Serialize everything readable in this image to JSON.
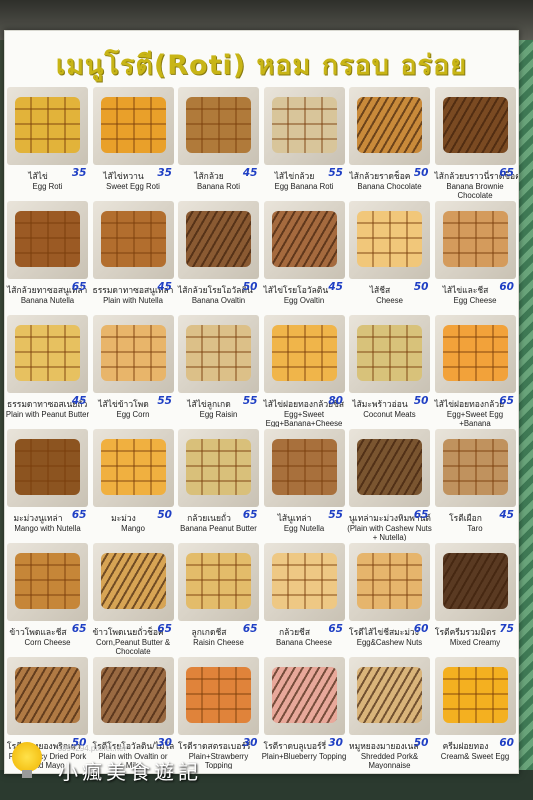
{
  "menu": {
    "title": "เมนูโรตี(Roti) หอม กรอบ อร่อย",
    "items": [
      {
        "thai": "ไส้ไข่",
        "price": "35",
        "english": "Egg Roti",
        "color": "#e2b33a",
        "pattern": "sq"
      },
      {
        "thai": "ไส้ไข่หวาน",
        "price": "35",
        "english": "Sweet Egg Roti",
        "color": "#e9a02a",
        "pattern": "sq"
      },
      {
        "thai": "ไส้กล้วย",
        "price": "45",
        "english": "Banana Roti",
        "color": "#b07a3a",
        "pattern": "sq"
      },
      {
        "thai": "ไส้ไข่กล้วย",
        "price": "55",
        "english": "Egg Banana Roti",
        "color": "#d8c59a",
        "pattern": "sq"
      },
      {
        "thai": "ไส้กล้วยราดช็อค",
        "price": "50",
        "english": "Banana Chocolate",
        "color": "#c98a3a",
        "pattern": "drz"
      },
      {
        "thai": "ไส้กล้วยบราวนี่ราดช็อค",
        "price": "65",
        "english": "Banana Brownie Chocolate",
        "color": "#7a4a22",
        "pattern": "drz"
      },
      {
        "thai": "ไส้กล้วยทาซอสนูเทล่า",
        "price": "65",
        "english": "Banana Nutella",
        "color": "#9b5a24",
        "pattern": "sq"
      },
      {
        "thai": "ธรรมดาทาซอสนูเทล่า",
        "price": "45",
        "english": "Plain with Nutella",
        "color": "#b26e2e",
        "pattern": "sq"
      },
      {
        "thai": "ไส้กล้วยโรยโอวัลติน",
        "price": "50",
        "english": "Banana Ovaltin",
        "color": "#8a5a32",
        "pattern": "drz"
      },
      {
        "thai": "ไส้ไข่โรยโอวัลติน",
        "price": "45",
        "english": "Egg Ovaltin",
        "color": "#a56a3e",
        "pattern": "drz"
      },
      {
        "thai": "ไส้ชีส",
        "price": "50",
        "english": "Cheese",
        "color": "#f1c77a",
        "pattern": "sq"
      },
      {
        "thai": "ไส้ไข่และชีส",
        "price": "60",
        "english": "Egg Cheese",
        "color": "#d49b5c",
        "pattern": "sq"
      },
      {
        "thai": "ธรรมดาทาซอสเนยถั่ว",
        "price": "45",
        "english": "Plain with Peanut Butter",
        "color": "#e7c160",
        "pattern": "sq"
      },
      {
        "thai": "ไส้ไข่ข้าวโพด",
        "price": "55",
        "english": "Egg Corn",
        "color": "#e8b56a",
        "pattern": "sq"
      },
      {
        "thai": "ไส้ไข่ลูกเกด",
        "price": "55",
        "english": "Egg Raisin",
        "color": "#dcc088",
        "pattern": "sq"
      },
      {
        "thai": "ไส้ไข่ฝอยทองกล้วยชีส",
        "price": "80",
        "english": "Egg+Sweet Egg+Banana+Cheese",
        "color": "#f0b54a",
        "pattern": "sq"
      },
      {
        "thai": "ไส้มะพร้าวอ่อน",
        "price": "50",
        "english": "Coconut Meats",
        "color": "#d8c27a",
        "pattern": "sq"
      },
      {
        "thai": "ไส้ไข่ฝอยทองกล้วย",
        "price": "65",
        "english": "Egg+Sweet Egg +Banana",
        "color": "#f2a23a",
        "pattern": "sq"
      },
      {
        "thai": "มะม่วงนูเทล่า",
        "price": "65",
        "english": "Mango with Nutella",
        "color": "#8c5420",
        "pattern": "sq"
      },
      {
        "thai": "มะม่วง",
        "price": "50",
        "english": "Mango",
        "color": "#f0b040",
        "pattern": "sq"
      },
      {
        "thai": "กล้วยเนยถั่ว",
        "price": "65",
        "english": "Banana Peanut Butter",
        "color": "#d9c07a",
        "pattern": "sq"
      },
      {
        "thai": "ไส้นูเทล่า",
        "price": "55",
        "english": "Egg Nutella",
        "color": "#a8703c",
        "pattern": "sq"
      },
      {
        "thai": "นูเทล่ามะม่วงหิมพานต์",
        "price": "65",
        "english": "(Plain with Cashew Nuts + Nutella)",
        "color": "#7a5530",
        "pattern": "drz"
      },
      {
        "thai": "โรตีเผือก",
        "price": "45",
        "english": "Taro",
        "color": "#c0925e",
        "pattern": "sq"
      },
      {
        "thai": "ข้าวโพดและชีส",
        "price": "65",
        "english": "Corn Cheese",
        "color": "#c68638",
        "pattern": "sq"
      },
      {
        "thai": "ข้าวโพดเนยถั่วช็อค",
        "price": "65",
        "english": "Corn,Peanut Butter & Chocolate",
        "color": "#d7a454",
        "pattern": "drz"
      },
      {
        "thai": "ลูกเกดชีส",
        "price": "65",
        "english": "Raisin Cheese",
        "color": "#e3bc6a",
        "pattern": "sq"
      },
      {
        "thai": "กล้วยชีส",
        "price": "65",
        "english": "Banana Cheese",
        "color": "#eec884",
        "pattern": "sq"
      },
      {
        "thai": "โรตีไส้ไข่ชีสมะม่วง",
        "price": "60",
        "english": "Egg&Cashew Nuts",
        "color": "#e6b56c",
        "pattern": "sq"
      },
      {
        "thai": "โรตีครีมรวมมิตร",
        "price": "75",
        "english": "Mixed Creamy",
        "color": "#5a3a22",
        "pattern": "drz"
      },
      {
        "thai": "โรตีหมูหยองพริกเผา",
        "price": "50",
        "english": "Plain Spicy Dried Pork and Mayo",
        "color": "#b07a44",
        "pattern": "drz"
      },
      {
        "thai": "โรตีโรยโอวัลติน/ไมโล",
        "price": "30",
        "english": "Plain with Ovaltin or Milo",
        "color": "#9a6a42",
        "pattern": "drz"
      },
      {
        "thai": "โรตีราดสตรอเบอร์รี่",
        "price": "30",
        "english": "Plain+Strawberry Topping",
        "color": "#e0833a",
        "pattern": "sq"
      },
      {
        "thai": "โรตีราดบลูเบอร์รี่",
        "price": "30",
        "english": "Plain+Blueberry Topping",
        "color": "#e8a89a",
        "pattern": "drz"
      },
      {
        "thai": "หมูหยองมายองเนส",
        "price": "50",
        "english": "Shredded Pork& Mayonnaise",
        "color": "#d9b47a",
        "pattern": "drz"
      },
      {
        "thai": "ครีมฝอยทอง",
        "price": "60",
        "english": "Cream& Sweet Egg",
        "color": "#f4b020",
        "pattern": "sq"
      }
    ]
  },
  "watermark": {
    "site": "s394294.pixnet.net",
    "brand": "小瘋美食遊記"
  }
}
